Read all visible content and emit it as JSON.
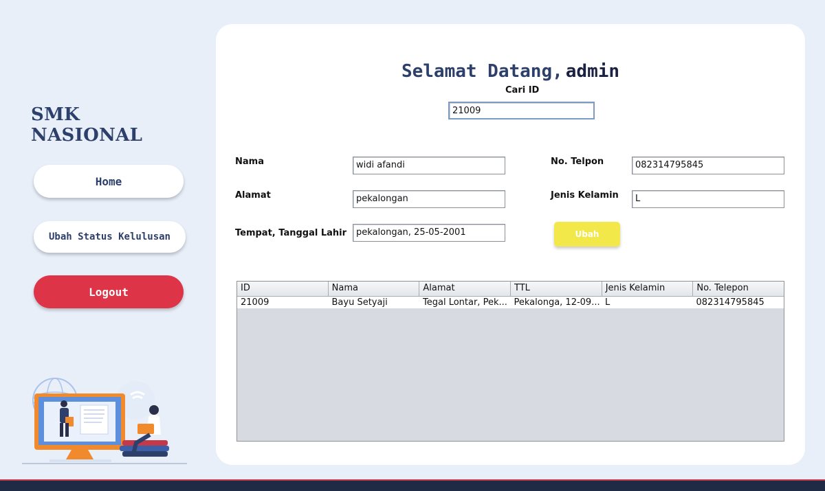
{
  "sidebar": {
    "brand": "SMK NASIONAL",
    "items": [
      {
        "label": "Home"
      },
      {
        "label": "Ubah Status Kelulusan"
      },
      {
        "label": "Logout"
      }
    ]
  },
  "main": {
    "welcome": "Selamat Datang,",
    "username": "admin",
    "search": {
      "label": "Cari ID",
      "value": "21009"
    },
    "form": {
      "nama": {
        "label": "Nama",
        "value": "widi afandi"
      },
      "alamat": {
        "label": "Alamat",
        "value": "pekalongan"
      },
      "ttl": {
        "label": "Tempat, Tanggal Lahir",
        "value": "pekalongan, 25-05-2001"
      },
      "telpon": {
        "label": "No. Telpon",
        "value": "082314795845"
      },
      "jenis_kelamin": {
        "label": "Jenis Kelamin",
        "value": "L"
      }
    },
    "ubah_label": "Ubah",
    "table": {
      "columns": [
        "ID",
        "Nama",
        "Alamat",
        "TTL",
        "Jenis Kelamin",
        "No. Telepon"
      ],
      "rows": [
        [
          "21009",
          "Bayu Setyaji",
          "Tegal Lontar, Pek...",
          "Pekalonga, 12-09...",
          "L",
          "082314795845"
        ]
      ]
    }
  },
  "colors": {
    "background": "#e8eff9",
    "navy": "#2d3f6b",
    "logout": "#dd3547",
    "ubah": "#f3e84a"
  }
}
